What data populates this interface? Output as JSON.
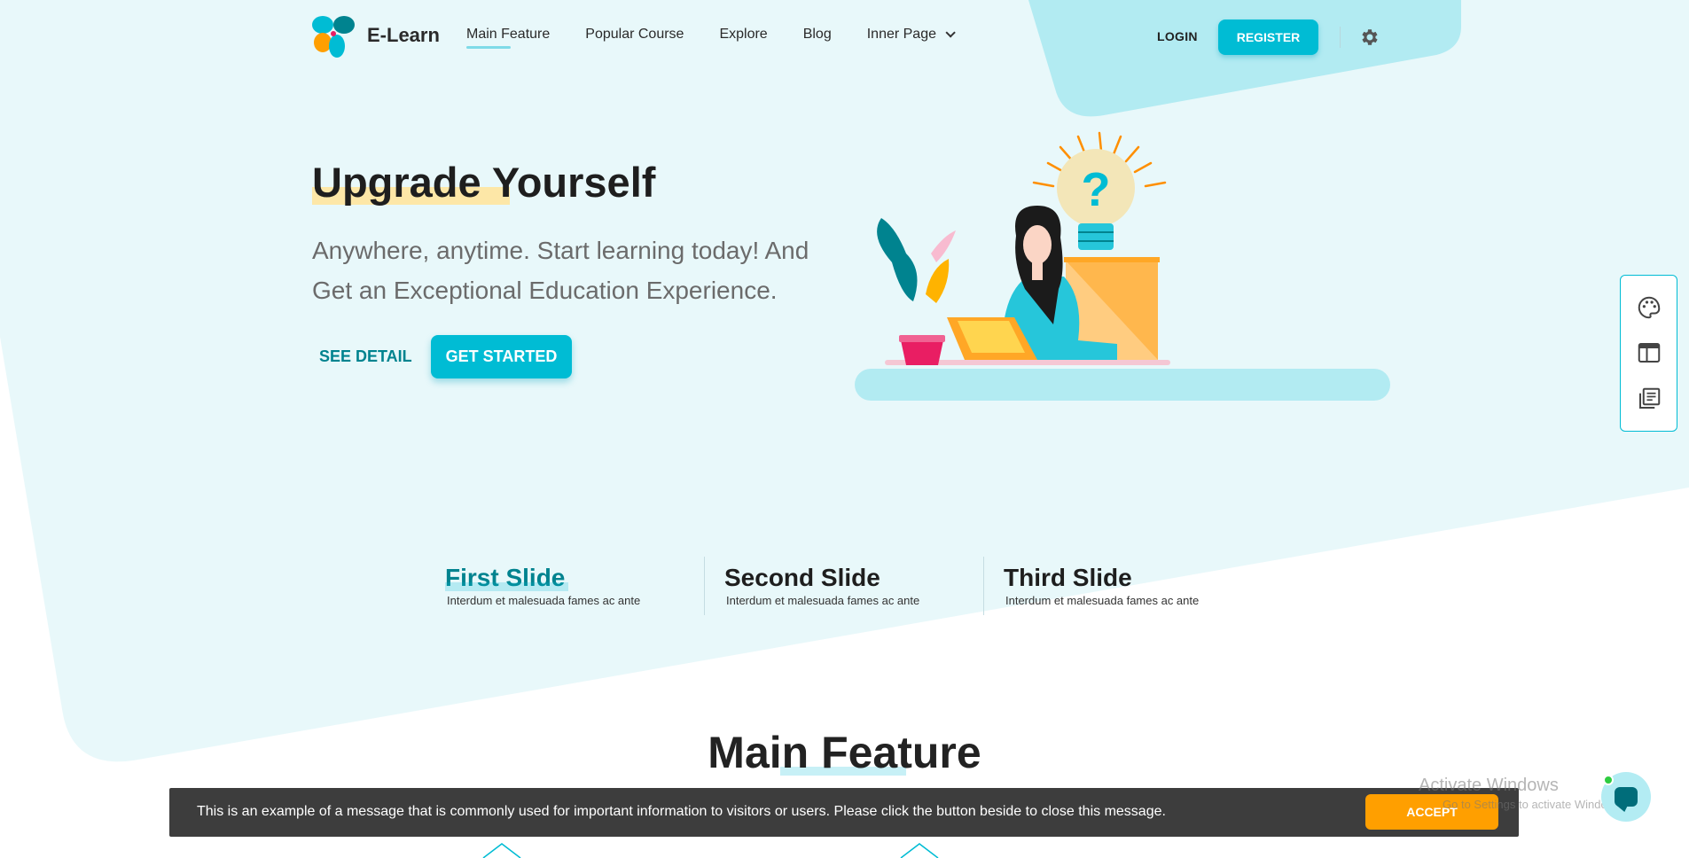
{
  "brand": {
    "name": "E-Learn"
  },
  "nav": {
    "items": [
      {
        "label": "Main Feature",
        "active": true
      },
      {
        "label": "Popular Course"
      },
      {
        "label": "Explore"
      },
      {
        "label": "Blog"
      },
      {
        "label": "Inner Page",
        "dropdown": true
      }
    ],
    "login_label": "LOGIN",
    "register_label": "REGISTER",
    "settings_icon": "gear-icon"
  },
  "hero": {
    "title": "Upgrade Yourself",
    "subtitle": "Anywhere, anytime. Start learning today! And Get an Exceptional Education Experience.",
    "see_detail_label": "SEE DETAIL",
    "get_started_label": "GET STARTED"
  },
  "side_panel": {
    "icons": [
      "palette-icon",
      "layout-icon",
      "library-icon"
    ]
  },
  "slides": [
    {
      "title": "First Slide",
      "subtitle": "Interdum et malesuada fames ac ante",
      "active": true
    },
    {
      "title": "Second Slide",
      "subtitle": "Interdum et malesuada fames ac ante"
    },
    {
      "title": "Third Slide",
      "subtitle": "Interdum et malesuada fames ac ante"
    }
  ],
  "main_feature": {
    "title": "Main Feature"
  },
  "cookie": {
    "message": "This is an example of a message that is commonly used for important information to visitors or users. Please click the button beside to close this message.",
    "accept_label": "ACCEPT"
  },
  "watermark": {
    "line1": "Activate Windows",
    "line2": "Go to Settings to activate Windows."
  },
  "colors": {
    "primary": "#00bcd4",
    "primary_dark": "#00838f",
    "hero_bg": "#e8f8fa",
    "accent_shape": "#b2ebf2",
    "highlight": "#fde7a7",
    "cookie_bg": "#3d3d3d",
    "accept": "#ff9f00"
  }
}
